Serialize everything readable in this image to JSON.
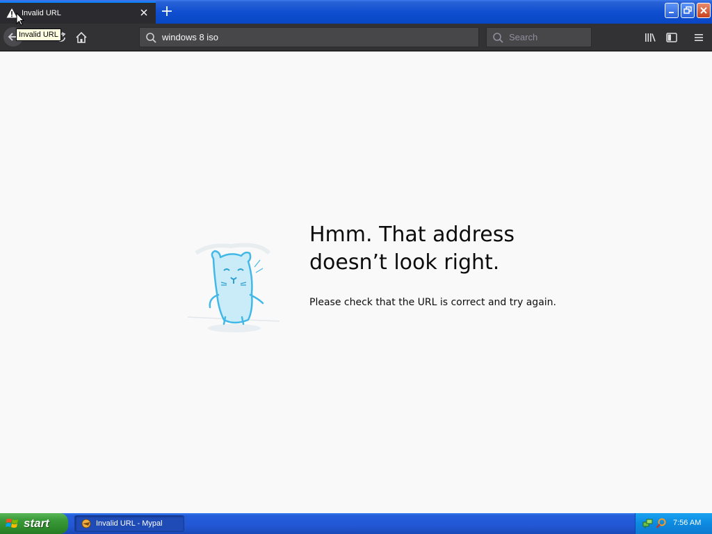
{
  "tab": {
    "title": "Invalid URL"
  },
  "tooltip": {
    "text": "Invalid URL"
  },
  "urlbar": {
    "value": "windows 8 iso"
  },
  "searchbar": {
    "placeholder": "Search"
  },
  "error": {
    "title_line1": "Hmm. That address",
    "title_line2": "doesn’t look right.",
    "description": "Please check that the URL is correct and try again."
  },
  "taskbar": {
    "start_label": "start",
    "window_item": "Invalid URL - Mypal",
    "clock": "7:56 AM"
  },
  "icons": {
    "tab": "warning-icon",
    "toolbar": [
      "back-arrow-icon",
      "reload-icon",
      "home-icon",
      "library-icon",
      "sidebar-icon",
      "hamburger-menu-icon"
    ]
  },
  "colors": {
    "tab_accent": "#0a84ff",
    "toolbar": "#323234",
    "content_bg": "#f9f9fa",
    "taskbar": "#245edb",
    "start_button": "#3c9b3a"
  }
}
